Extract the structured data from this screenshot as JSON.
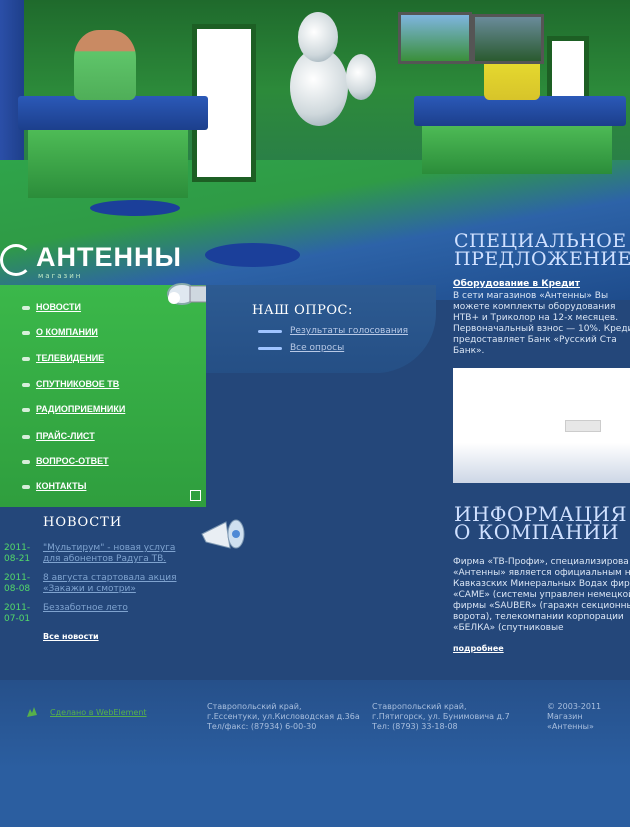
{
  "logo": {
    "title": "АНТЕННЫ",
    "subtitle": "магазин"
  },
  "menu": {
    "items": [
      {
        "label": "НОВОСТИ"
      },
      {
        "label": "О КОМПАНИИ"
      },
      {
        "label": "ТЕЛЕВИДЕНИЕ"
      },
      {
        "label": "СПУТНИКОВОЕ ТВ"
      },
      {
        "label": "РАДИОПРИЕМНИКИ"
      },
      {
        "label": "ПРАЙС-ЛИСТ"
      },
      {
        "label": "ВОПРОС-ОТВЕТ"
      },
      {
        "label": "КОНТАКТЫ"
      }
    ]
  },
  "poll": {
    "title": "НАШ ОПРОС:",
    "links": [
      "Результаты голосования",
      "Все опросы"
    ]
  },
  "news": {
    "title": "НОВОСТИ",
    "items": [
      {
        "date_year": "2011-",
        "date_md": "08-21",
        "text": "\"Мультирум\" - новая услуга для абонентов Радуга ТВ."
      },
      {
        "date_year": "2011-",
        "date_md": "08-08",
        "text": "8 августа стартовала акция «Закажи и смотри»"
      },
      {
        "date_year": "2011-",
        "date_md": "07-01",
        "text": "Беззаботное лето"
      }
    ],
    "all_label": "Все новости"
  },
  "special": {
    "title_line1": "СПЕЦИАЛЬНОЕ",
    "title_line2": "ПРЕДЛОЖЕНИЕ",
    "link": "Оборудование в Кредит",
    "text": "В сети магазинов «Антенны» Вы можете комплекты оборудования НТВ+ и Триколор на 12-х месяцев. Первоначальный взнос — 10%. Кредит предоставляет Банк «Русский Ста Банк»."
  },
  "about": {
    "title_line1": "ИНФОРМАЦИЯ",
    "title_line2": "О КОМПАНИИ",
    "text": "Фирма «ТВ-Профи», специализирова «Антенны» является официальным на Кавказских Минеральных Водах фирмы «CAME» (системы управлен немецкой фирмы «SAUBER» (гаражн секционные ворота), телекомпании корпорации «БЕЛКА» (спутниковые",
    "more": "подробнее"
  },
  "footer": {
    "made_by": "Сделано в WebElement",
    "addr1_line1": "Ставропольский край,",
    "addr1_line2": "г.Ессентуки, ул.Кисловодская д.36а",
    "addr1_line3": "Тел/факс: (87934) 6-00-30",
    "addr2_line1": "Ставропольский край,",
    "addr2_line2": "г.Пятигорск, ул. Бунимовича д.7",
    "addr2_line3": "Тел: (8793) 33-18-08",
    "copy_line1": "© 2003-2011",
    "copy_line2": "Магазин «Антенны»"
  },
  "colors": {
    "menu_green": "#3bb84a",
    "page_blue": "#24477a",
    "heading_blue": "#cfe0ff",
    "date_green": "#53d86a"
  }
}
